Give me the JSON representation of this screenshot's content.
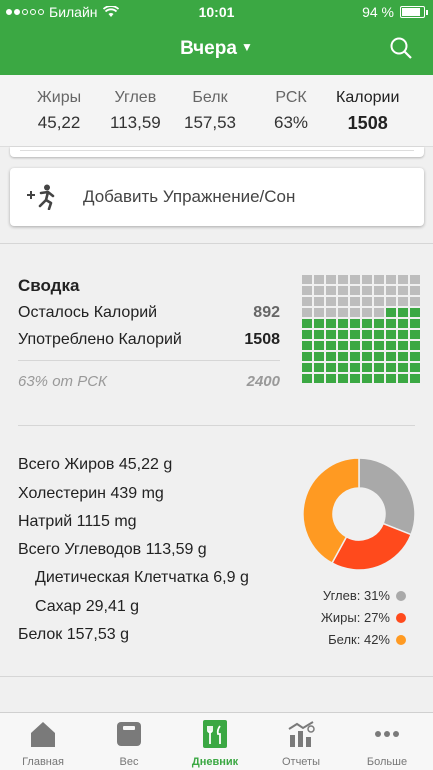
{
  "status": {
    "carrier": "Билайн",
    "time": "10:01",
    "battery": "94 %"
  },
  "nav": {
    "title": "Вчера",
    "caret": "▼"
  },
  "macros": [
    {
      "label": "Жиры",
      "value": "45,22"
    },
    {
      "label": "Углев",
      "value": "113,59"
    },
    {
      "label": "Белк",
      "value": "157,53"
    },
    {
      "label": "РСК",
      "value": "63%"
    },
    {
      "label": "Калории",
      "value": "1508"
    }
  ],
  "add_exercise": {
    "label": "Добавить Упражнение/Сон"
  },
  "summary": {
    "title": "Сводка",
    "remaining_label": "Осталось Калорий",
    "remaining_value": "892",
    "consumed_label": "Употреблено Калорий",
    "consumed_value": "1508",
    "rsk_label": "63% от РСК",
    "rsk_value": "2400",
    "waffle_filled_fraction": 0.63
  },
  "nutrients": [
    "Всего Жиров 45,22 g",
    "Холестерин 439 mg",
    "Натрий 1115 mg",
    "Всего Углеводов 113,59 g",
    "Диетическая Клетчатка 6,9 g",
    "Сахар 29,41 g",
    "Белок 157,53 g"
  ],
  "chart_data": {
    "type": "pie",
    "categories": [
      "Углев",
      "Жиры",
      "Белк"
    ],
    "values": [
      31,
      27,
      42
    ],
    "colors": [
      "#a9a9a9",
      "#ff4a1c",
      "#ff9a22"
    ]
  },
  "legend": [
    {
      "text": "Углев: 31%",
      "color": "#a9a9a9"
    },
    {
      "text": "Жиры: 27%",
      "color": "#ff4a1c"
    },
    {
      "text": "Белк: 42%",
      "color": "#ff9a22"
    }
  ],
  "tabs": [
    {
      "label": "Главная",
      "icon": "home-icon"
    },
    {
      "label": "Вес",
      "icon": "scale-icon"
    },
    {
      "label": "Дневник",
      "icon": "diary-icon",
      "active": true
    },
    {
      "label": "Отчеты",
      "icon": "reports-icon"
    },
    {
      "label": "Больше",
      "icon": "more-icon"
    }
  ],
  "colors": {
    "brand": "#3ba843",
    "carbs": "#a9a9a9",
    "fat": "#ff4a1c",
    "protein": "#ff9a22"
  }
}
